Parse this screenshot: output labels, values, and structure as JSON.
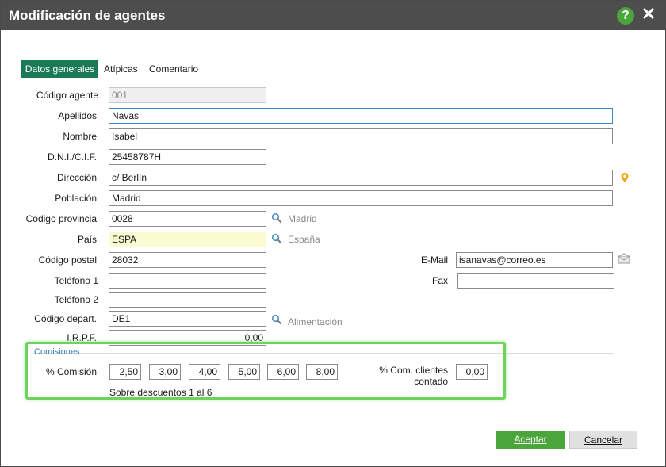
{
  "window": {
    "title": "Modificación de agentes"
  },
  "tabs": [
    {
      "label": "Datos generales"
    },
    {
      "label": "Atípicas"
    },
    {
      "label": "Comentario"
    }
  ],
  "form": {
    "codigo_agente": {
      "label": "Código agente",
      "value": "001"
    },
    "apellidos": {
      "label": "Apellidos",
      "value": "Navas"
    },
    "nombre": {
      "label": "Nombre",
      "value": "Isabel"
    },
    "dni": {
      "label": "D.N.I./C.I.F.",
      "value": "25458787H"
    },
    "direccion": {
      "label": "Dirección",
      "value": "c/ Berlín"
    },
    "poblacion": {
      "label": "Población",
      "value": "Madrid"
    },
    "codigo_provincia": {
      "label": "Código provincia",
      "value": "0028",
      "desc": "Madrid"
    },
    "pais": {
      "label": "País",
      "value": "ESPA",
      "desc": "España"
    },
    "codigo_postal": {
      "label": "Código postal",
      "value": "28032"
    },
    "email": {
      "label": "E-Mail",
      "value": "isanavas@correo.es"
    },
    "telefono1": {
      "label": "Teléfono 1",
      "value": ""
    },
    "fax": {
      "label": "Fax",
      "value": ""
    },
    "telefono2": {
      "label": "Teléfono 2",
      "value": ""
    },
    "codigo_depart": {
      "label": "Código depart.",
      "value": "DE1",
      "desc": "Alimentación"
    },
    "irpf": {
      "label": "I.R.P.F.",
      "value": "0,00"
    }
  },
  "comisiones": {
    "section_label": "Comisiones",
    "label": "% Comisión",
    "values": [
      "2,50",
      "3,00",
      "4,00",
      "5,00",
      "6,00",
      "8,00"
    ],
    "note": "Sobre descuentos 1 al 6",
    "contado_label": "% Com. clientes contado",
    "contado_value": "0,00"
  },
  "buttons": {
    "ok": "Aceptar",
    "cancel": "Cancelar"
  },
  "colors": {
    "titlebar": "#4d4d4d",
    "accent_green": "#4aa63a",
    "tab_active": "#1a7a56",
    "highlight": "#6fd25a"
  },
  "icons": [
    "help-icon",
    "close-icon",
    "search-icon",
    "map-pin-icon",
    "email-icon"
  ]
}
